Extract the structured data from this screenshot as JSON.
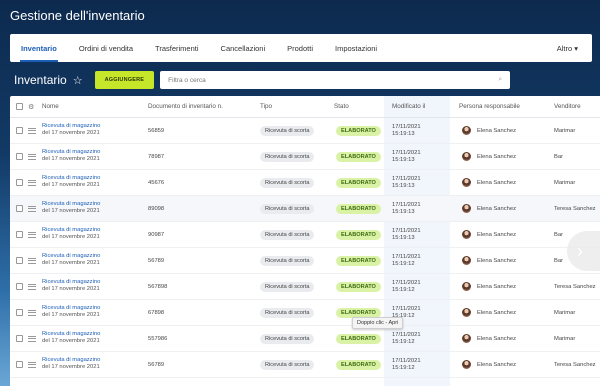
{
  "app": {
    "title": "Gestione dell'inventario"
  },
  "tabs": [
    "Inventario",
    "Ordini di vendita",
    "Trasferimenti",
    "Cancellazioni",
    "Prodotti",
    "Impostazioni"
  ],
  "tab_more": "Altro ▾",
  "toolbar": {
    "title": "Inventario",
    "add_label": "AGGIUNGERE",
    "search_placeholder": "Filtra o cerca"
  },
  "columns": {
    "name": "Nome",
    "doc": "Documento di inventario n.",
    "type": "Tipo",
    "status": "Stato",
    "modified": "Modificato il",
    "person": "Persona responsabile",
    "vendor": "Venditore"
  },
  "rows": [
    {
      "name": "Ricevuta di magazzino",
      "date": "del 17 novembre 2021",
      "doc": "56859",
      "type": "Ricevuta di scorta",
      "status": "ELABORATO",
      "mod_date": "17/11/2021",
      "mod_time": "15:19:13",
      "person": "Elena Sanchez",
      "vendor": "Marimar"
    },
    {
      "name": "Ricevuta di magazzino",
      "date": "del 17 novembre 2021",
      "doc": "78987",
      "type": "Ricevuta di scorta",
      "status": "ELABORATO",
      "mod_date": "17/11/2021",
      "mod_time": "15:19:13",
      "person": "Elena Sanchez",
      "vendor": "Bar"
    },
    {
      "name": "Ricevuta di magazzino",
      "date": "del 17 novembre 2021",
      "doc": "45676",
      "type": "Ricevuta di scorta",
      "status": "ELABORATO",
      "mod_date": "17/11/2021",
      "mod_time": "15:19:13",
      "person": "Elena Sanchez",
      "vendor": "Marimar"
    },
    {
      "name": "Ricevuta di magazzino",
      "date": "del 17 novembre 2021",
      "doc": "89098",
      "type": "Ricevuta di scorta",
      "status": "ELABORATO",
      "mod_date": "17/11/2021",
      "mod_time": "15:19:13",
      "person": "Elena Sanchez",
      "vendor": "Teresa Sanchez"
    },
    {
      "name": "Ricevuta di magazzino",
      "date": "del 17 novembre 2021",
      "doc": "90987",
      "type": "Ricevuta di scorta",
      "status": "ELABORATO",
      "mod_date": "17/11/2021",
      "mod_time": "15:19:13",
      "person": "Elena Sanchez",
      "vendor": "Bar"
    },
    {
      "name": "Ricevuta di magazzino",
      "date": "del 17 novembre 2021",
      "doc": "56789",
      "type": "Ricevuta di scorta",
      "status": "ELABORATO",
      "mod_date": "17/11/2021",
      "mod_time": "15:19:12",
      "person": "Elena Sanchez",
      "vendor": "Bar"
    },
    {
      "name": "Ricevuta di magazzino",
      "date": "del 17 novembre 2021",
      "doc": "567898",
      "type": "Ricevuta di scorta",
      "status": "ELABORATO",
      "mod_date": "17/11/2021",
      "mod_time": "15:19:12",
      "person": "Elena Sanchez",
      "vendor": "Teresa Sanchez"
    },
    {
      "name": "Ricevuta di magazzino",
      "date": "del 17 novembre 2021",
      "doc": "67898",
      "type": "Ricevuta di scorta",
      "status": "ELABORATO",
      "mod_date": "17/11/2021",
      "mod_time": "15:19:12",
      "person": "Elena Sanchez",
      "vendor": "Marimar"
    },
    {
      "name": "Ricevuta di magazzino",
      "date": "del 17 novembre 2021",
      "doc": "557986",
      "type": "Ricevuta di scorta",
      "status": "ELABORATO",
      "mod_date": "17/11/2021",
      "mod_time": "15:19:12",
      "person": "Elena Sanchez",
      "vendor": "Marimar"
    },
    {
      "name": "Ricevuta di magazzino",
      "date": "del 17 novembre 2021",
      "doc": "56789",
      "type": "Ricevuta di scorta",
      "status": "ELABORATO",
      "mod_date": "17/11/2021",
      "mod_time": "15:19:12",
      "person": "Elena Sanchez",
      "vendor": "Teresa Sanchez"
    }
  ],
  "tooltip": "Doppio clic - Apri",
  "icons": {
    "star": "star-icon",
    "search": "search-icon",
    "settings": "gear-icon",
    "drag": "drag-handle-icon",
    "next": "chevron-right-icon"
  },
  "colors": {
    "accent": "#1d5fb6",
    "add_button": "#c6e629",
    "status_bg": "#d9f2a6"
  }
}
